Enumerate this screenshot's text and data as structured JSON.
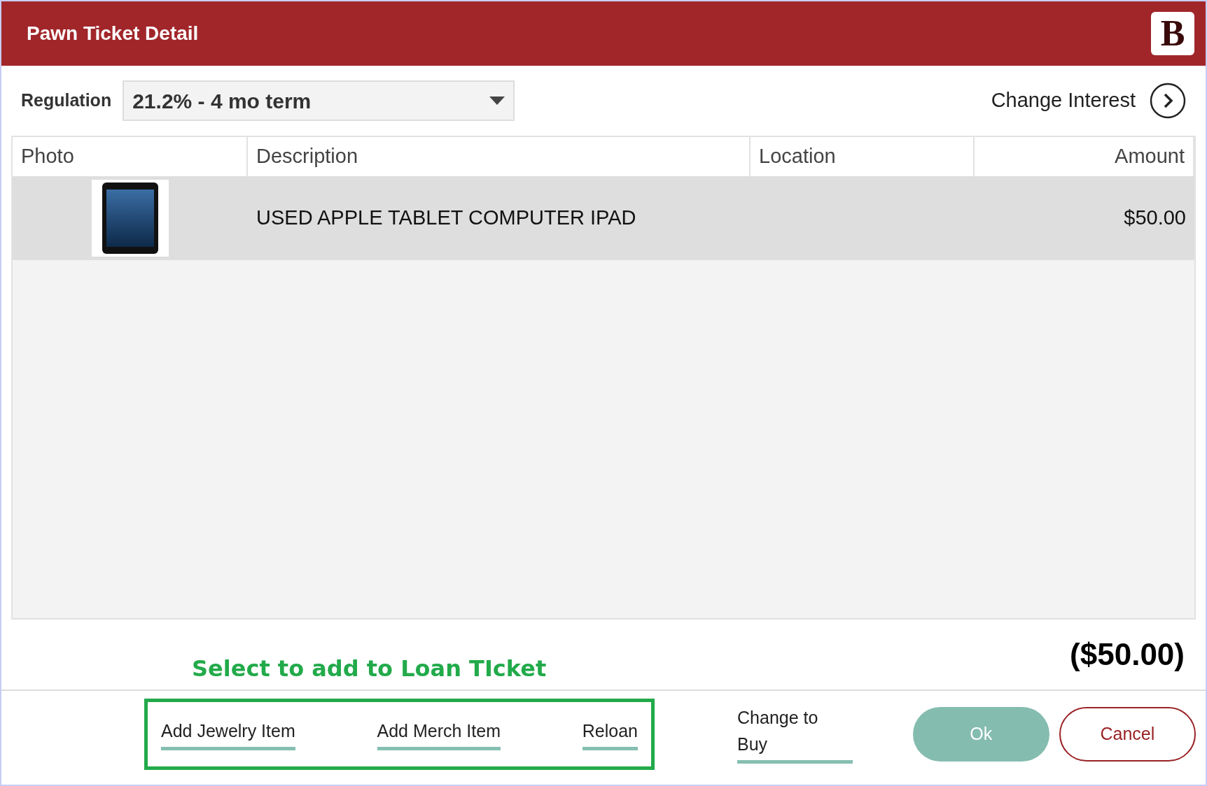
{
  "window": {
    "title": "Pawn Ticket Detail",
    "logo": "B"
  },
  "regulation": {
    "label": "Regulation",
    "value": "21.2% - 4 mo term"
  },
  "change_interest": {
    "label": "Change Interest"
  },
  "table": {
    "columns": [
      "Photo",
      "Description",
      "Location",
      "Amount"
    ],
    "rows": [
      {
        "description": "USED APPLE TABLET COMPUTER IPAD",
        "location": "",
        "amount": "$50.00",
        "selected": true
      }
    ]
  },
  "total": "($50.00)",
  "annotation": "Select to add to Loan TIcket",
  "item_links": [
    "Add Jewelry Item",
    "Add Merch Item",
    "Reloan"
  ],
  "change_to_buy": "Change to Buy",
  "buttons": {
    "ok": "Ok",
    "cancel": "Cancel"
  }
}
